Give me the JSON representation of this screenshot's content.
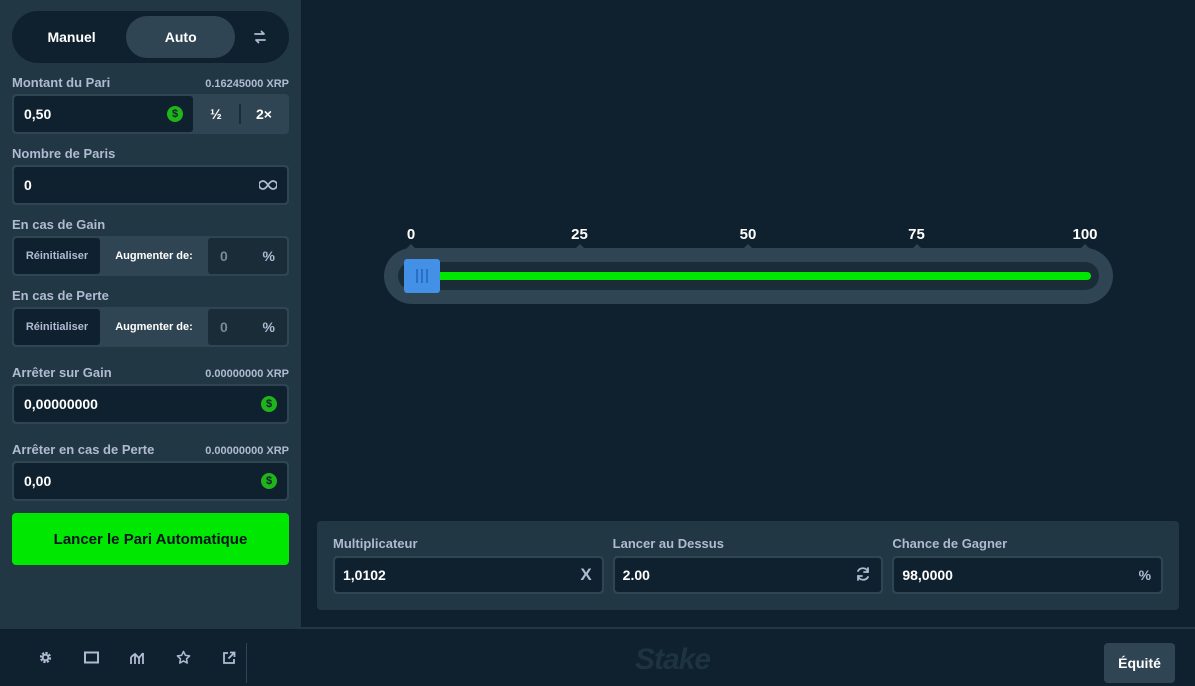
{
  "mode": {
    "manual_label": "Manuel",
    "auto_label": "Auto",
    "active": "auto"
  },
  "bet_amount": {
    "label": "Montant du Pari",
    "balance": "0.16245000 XRP",
    "value": "0,50",
    "half_label": "½",
    "double_label": "2×"
  },
  "num_bets": {
    "label": "Nombre de Paris",
    "value": "0"
  },
  "on_win": {
    "label": "En cas de Gain",
    "reset_label": "Réinitialiser",
    "increase_label": "Augmenter de:",
    "value": "0",
    "unit": "%"
  },
  "on_loss": {
    "label": "En cas de Perte",
    "reset_label": "Réinitialiser",
    "increase_label": "Augmenter de:",
    "value": "0",
    "unit": "%"
  },
  "stop_on_profit": {
    "label": "Arrêter sur Gain",
    "side": "0.00000000 XRP",
    "value": "0,00000000"
  },
  "stop_on_loss": {
    "label": "Arrêter en cas de Perte",
    "side": "0.00000000 XRP",
    "value": "0,00"
  },
  "launch_label": "Lancer le Pari Automatique",
  "slider": {
    "ticks": [
      "0",
      "25",
      "50",
      "75",
      "100"
    ],
    "value": 2
  },
  "info": {
    "multiplier": {
      "label": "Multiplicateur",
      "value": "1,0102",
      "suffix": "X"
    },
    "roll_over": {
      "label": "Lancer au Dessus",
      "value": "2.00"
    },
    "win_chance": {
      "label": "Chance de Gagner",
      "value": "98,0000",
      "suffix": "%"
    }
  },
  "footer": {
    "logo": "Stake",
    "fairness_label": "Équité"
  },
  "colors": {
    "green": "#00e701",
    "red": "#ff2c55",
    "handle": "#4391e7",
    "panel": "#213743",
    "bg": "#0f212e"
  },
  "icons": [
    "swap-icon",
    "coin-icon",
    "infinity-icon",
    "refresh-icon",
    "settings-icon",
    "theatre-icon",
    "stats-icon",
    "star-icon",
    "popout-icon"
  ]
}
